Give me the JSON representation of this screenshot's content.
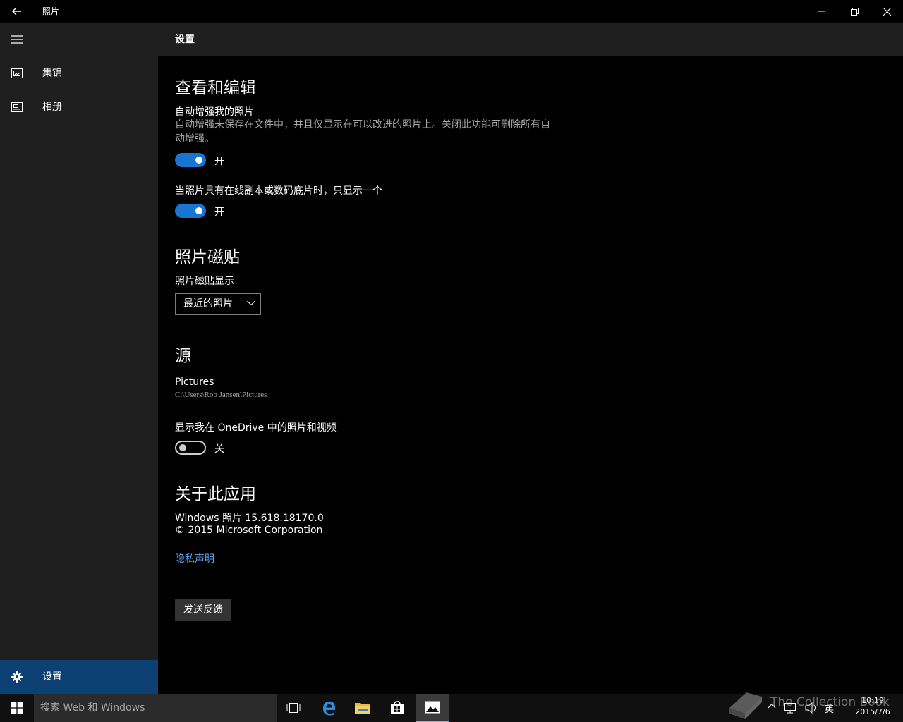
{
  "window": {
    "title": "照片"
  },
  "sidebar": {
    "items": [
      {
        "label": "集锦",
        "icon": "collection-icon"
      },
      {
        "label": "相册",
        "icon": "album-icon"
      }
    ],
    "settings_label": "设置"
  },
  "header": {
    "title": "设置"
  },
  "sections": {
    "view_edit": {
      "heading": "查看和编辑",
      "auto_enhance": {
        "label": "自动增强我的照片",
        "description": "自动增强未保存在文件中，并且仅显示在可以改进的照片上。关闭此功能可删除所有自动增强。",
        "state": "开"
      },
      "duplicates": {
        "label": "当照片具有在线副本或数码底片时，只显示一个",
        "state": "开"
      }
    },
    "tile": {
      "heading": "照片磁贴",
      "label": "照片磁贴显示",
      "dropdown_value": "最近的照片"
    },
    "source": {
      "heading": "源",
      "folder_name": "Pictures",
      "folder_path": "C:\\Users\\Rob Jansen\\Pictures",
      "onedrive_label": "显示我在 OneDrive 中的照片和视频",
      "onedrive_state": "关"
    },
    "about": {
      "heading": "关于此应用",
      "version": "Windows 照片 15.618.18170.0",
      "copyright": "© 2015 Microsoft Corporation",
      "privacy_link": "隐私声明",
      "feedback_button": "发送反馈"
    }
  },
  "taskbar": {
    "search_placeholder": "搜索 Web 和 Windows",
    "time": "10:19",
    "date": "2015/7/6",
    "input_language": "英"
  },
  "watermark": {
    "text": "The Collection Book"
  },
  "colors": {
    "accent": "#1875d1",
    "sidebar_bg": "#1f1f1f",
    "selected_bg": "#0c3f72",
    "link": "#5fa2e6"
  }
}
